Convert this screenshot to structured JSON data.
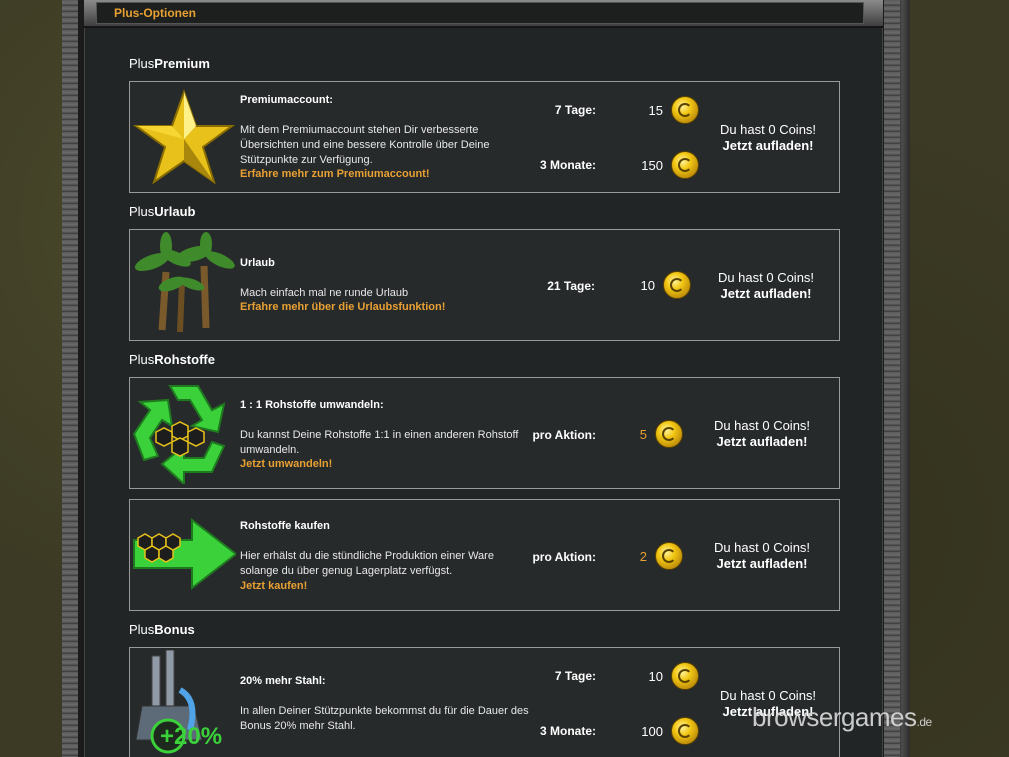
{
  "header": {
    "title": "Plus-Optionen"
  },
  "sections": {
    "premium": {
      "prefix": "Plus",
      "name": "Premium"
    },
    "urlaub": {
      "prefix": "Plus",
      "name": "Urlaub"
    },
    "rohstoffe": {
      "prefix": "Plus",
      "name": "Rohstoffe"
    },
    "bonus": {
      "prefix": "Plus",
      "name": "Bonus"
    }
  },
  "cards": {
    "premium": {
      "name": "Premiumaccount:",
      "desc": "Mit dem Premiumaccount stehen Dir verbesserte Übersichten und eine bessere Kontrolle über Deine Stützpunkte zur Verfügung.",
      "more": "Erfahre mehr zum Premiumaccount!",
      "prices": [
        {
          "label": "7 Tage:",
          "value": "15"
        },
        {
          "label": "3 Monate:",
          "value": "150"
        }
      ],
      "coins": "Du hast 0 Coins!",
      "reload": "Jetzt aufladen!"
    },
    "urlaub": {
      "name": "Urlaub",
      "desc": "Mach einfach mal ne runde Urlaub",
      "more": "Erfahre mehr über die Urlaubsfunktion!",
      "prices": [
        {
          "label": "21 Tage:",
          "value": "10"
        }
      ],
      "coins": "Du hast 0 Coins!",
      "reload": "Jetzt aufladen!"
    },
    "umwandeln": {
      "name": "1 : 1 Rohstoffe umwandeln:",
      "desc": "Du kannst Deine Rohstoffe 1:1 in einen anderen Rohstoff umwandeln.",
      "more": "Jetzt umwandeln!",
      "prices": [
        {
          "label": "pro Aktion:",
          "value": "5"
        }
      ],
      "coins": "Du hast 0 Coins!",
      "reload": "Jetzt aufladen!"
    },
    "kaufen": {
      "name": "Rohstoffe kaufen",
      "desc": "Hier erhälst du die stündliche Produktion einer Ware solange du über genug Lagerplatz verfügst.",
      "more": "Jetzt kaufen!",
      "prices": [
        {
          "label": "pro Aktion:",
          "value": "2"
        }
      ],
      "coins": "Du hast 0 Coins!",
      "reload": "Jetzt aufladen!"
    },
    "stahl": {
      "name": "20% mehr Stahl:",
      "desc": "In allen Deiner Stützpunkte bekommst du für die Dauer des Bonus 20% mehr Stahl.",
      "badge": "+20%",
      "prices": [
        {
          "label": "7 Tage:",
          "value": "10"
        },
        {
          "label": "3 Monate:",
          "value": "100"
        }
      ],
      "coins": "Du hast 0 Coins!",
      "reload": "Jetzt aufladen!"
    }
  },
  "watermark": {
    "brand": "browsergames",
    "tld": ".de"
  },
  "colors": {
    "accent": "#e8a033",
    "panel": "#272a2b",
    "border": "#9a9a9a"
  }
}
